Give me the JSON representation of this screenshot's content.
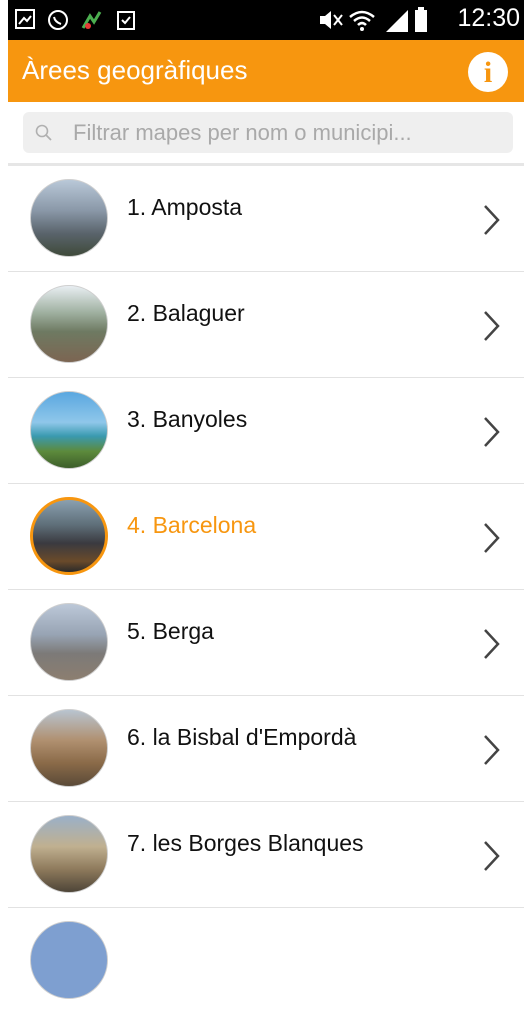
{
  "status_bar": {
    "time": "12:30",
    "icons": [
      "gallery-icon",
      "whatsapp-icon",
      "app-notification-icon",
      "clipboard-check-icon",
      "mute-icon",
      "wifi-icon",
      "signal-icon",
      "battery-icon"
    ]
  },
  "app_bar": {
    "title": "Àrees geogràfiques",
    "info_glyph": "i",
    "accent_color": "#f7960f"
  },
  "search": {
    "placeholder": "Filtrar mapes per nom o municipi..."
  },
  "list": {
    "items": [
      {
        "label": "1. Amposta",
        "selected": false
      },
      {
        "label": "2. Balaguer",
        "selected": false
      },
      {
        "label": "3. Banyoles",
        "selected": false
      },
      {
        "label": "4. Barcelona",
        "selected": true
      },
      {
        "label": "5. Berga",
        "selected": false
      },
      {
        "label": "6. la Bisbal d'Empordà",
        "selected": false
      },
      {
        "label": "7. les Borges Blanques",
        "selected": false
      }
    ]
  }
}
